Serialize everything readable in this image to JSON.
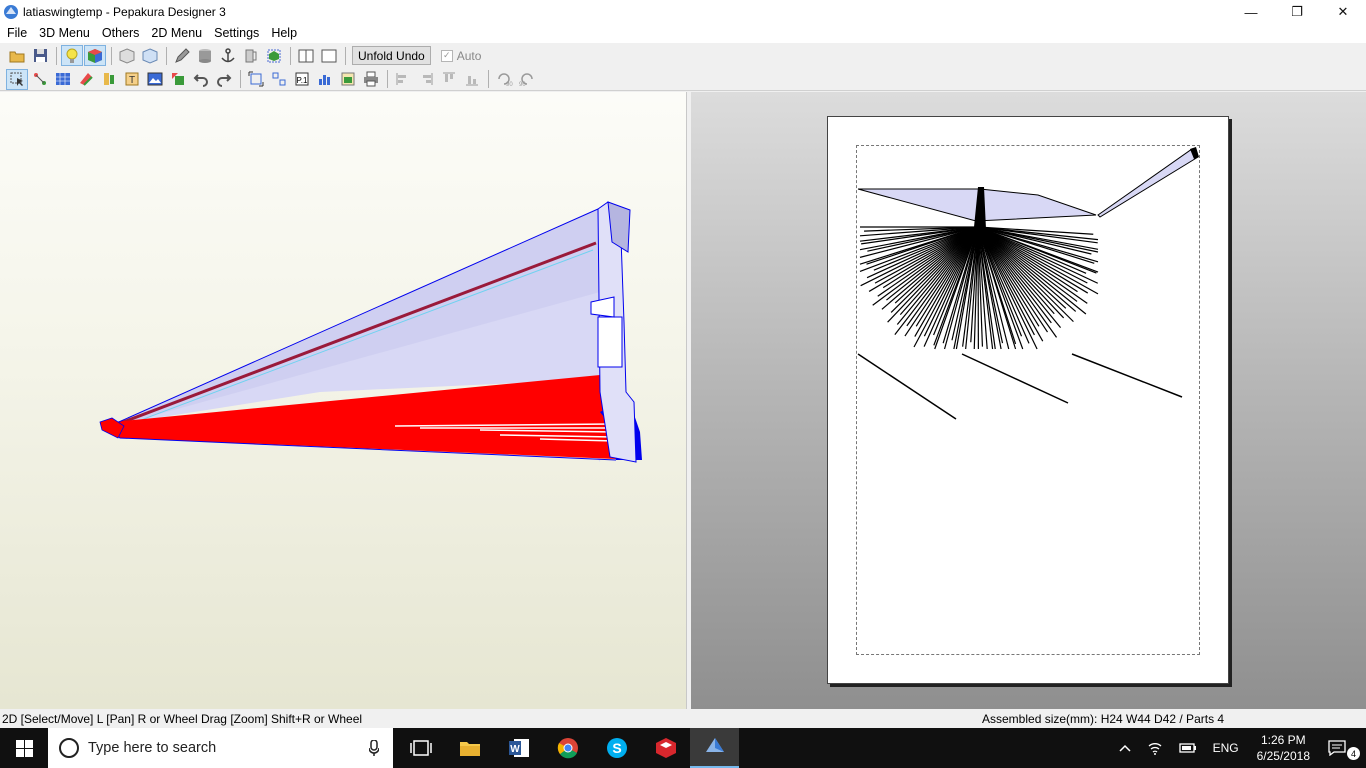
{
  "window": {
    "title": "latiaswingtemp - Pepakura Designer 3",
    "controls": {
      "minimize": "—",
      "restore": "❐",
      "close": "✕"
    }
  },
  "menubar": {
    "items": [
      {
        "label": "File"
      },
      {
        "label": "3D Menu"
      },
      {
        "label": "Others"
      },
      {
        "label": "2D Menu"
      },
      {
        "label": "Settings"
      },
      {
        "label": "Help"
      }
    ]
  },
  "toolbar1": {
    "unfold_undo_label": "Unfold Undo",
    "auto_label": "Auto",
    "auto_checked": true
  },
  "statusbar": {
    "left": "2D [Select/Move] L [Pan] R or Wheel Drag [Zoom] Shift+R or Wheel",
    "right": "Assembled size(mm): H24 W44 D42 / Parts 4"
  },
  "taskbar": {
    "search_placeholder": "Type here to search",
    "language": "ENG",
    "time": "1:26 PM",
    "date": "6/25/2018",
    "notification_count": "4"
  },
  "colors": {
    "model_red": "#ff0000",
    "model_lavender": "#d8d8f5",
    "edge_blue": "#0000ee",
    "accent": "#76b9ed"
  }
}
